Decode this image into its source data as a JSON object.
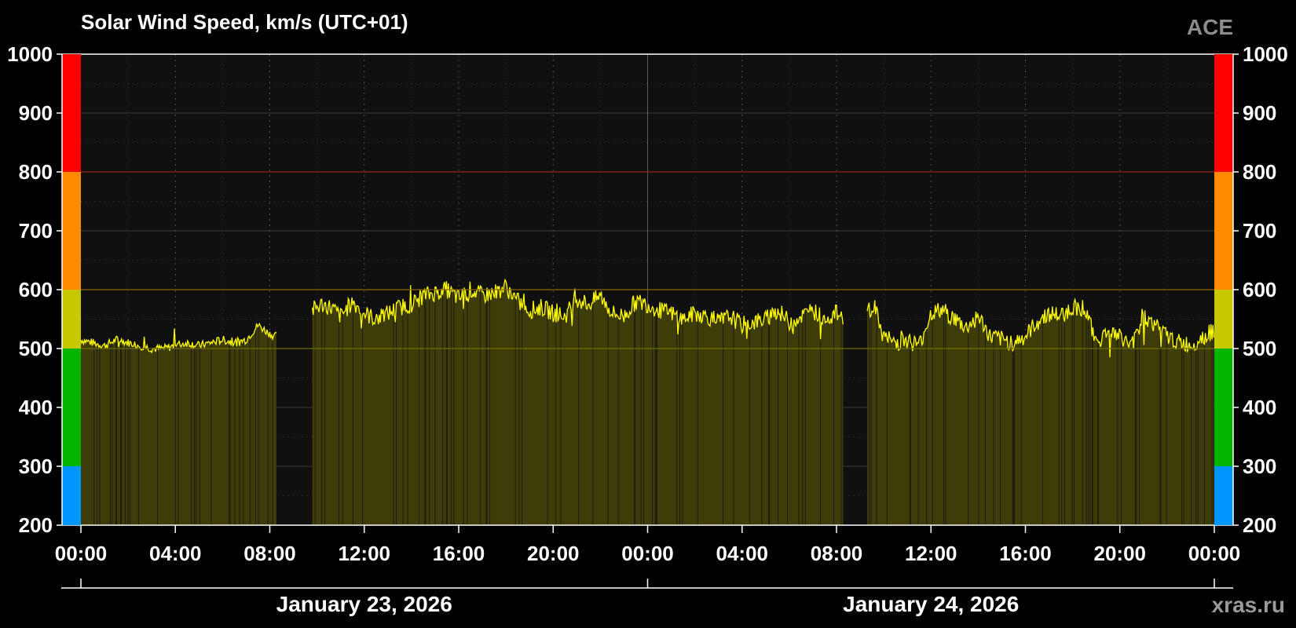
{
  "chart_data": {
    "type": "area",
    "title": "Solar Wind Speed, km/s (UTC+01)",
    "source_label": "ACE",
    "watermark": "xras.ru",
    "y_ticks": [
      200,
      300,
      400,
      500,
      600,
      700,
      800,
      900,
      1000
    ],
    "ylim": [
      200,
      1000
    ],
    "x_ticks": [
      "00:00",
      "04:00",
      "08:00",
      "12:00",
      "16:00",
      "20:00",
      "00:00",
      "04:00",
      "08:00",
      "12:00",
      "16:00",
      "20:00",
      "00:00"
    ],
    "x_range_hours": [
      0,
      48
    ],
    "date_labels": [
      {
        "text": "January 23, 2026",
        "center_hour": 12
      },
      {
        "text": "January 24, 2026",
        "center_hour": 36
      }
    ],
    "threshold_bands": [
      {
        "from": 200,
        "to": 300,
        "color": "#0096ff"
      },
      {
        "from": 300,
        "to": 500,
        "color": "#00b400"
      },
      {
        "from": 500,
        "to": 600,
        "color": "#c8c800"
      },
      {
        "from": 600,
        "to": 800,
        "color": "#ff8c00"
      },
      {
        "from": 800,
        "to": 1000,
        "color": "#ff0000"
      }
    ],
    "threshold_lines": [
      {
        "value": 500,
        "color": "#6e6e00"
      },
      {
        "value": 600,
        "color": "#8c6400"
      },
      {
        "value": 800,
        "color": "#a01e1e"
      }
    ],
    "series": [
      {
        "line_color": "#ffff00",
        "fill_color": "#3e3c08",
        "segments": [
          {
            "t": [
              0.0,
              0.5,
              1.0,
              1.5,
              2.0,
              2.5,
              3.0,
              3.5,
              4.0,
              4.5,
              5.0,
              5.5,
              6.0,
              6.5,
              7.0,
              7.5,
              8.0,
              8.3
            ],
            "v": [
              515,
              510,
              505,
              515,
              510,
              505,
              500,
              500,
              505,
              510,
              505,
              510,
              515,
              510,
              515,
              540,
              525,
              520
            ]
          },
          {
            "t": [
              9.8,
              10.2,
              10.6,
              11.0,
              11.5,
              12.0,
              12.5,
              13.0,
              13.5,
              14.0,
              14.5,
              15.0,
              15.5,
              16.0,
              16.5,
              17.0,
              17.5,
              18.0,
              18.5,
              19.0,
              19.5,
              20.0,
              20.5,
              21.0,
              21.5,
              22.0,
              22.5,
              23.0,
              23.5,
              24.0,
              24.5,
              25.0,
              25.5,
              26.0,
              26.5,
              27.0,
              27.5,
              28.0,
              28.5,
              29.0,
              29.5,
              30.0,
              30.5,
              31.0,
              31.5,
              32.0,
              32.3
            ],
            "v": [
              565,
              575,
              570,
              555,
              580,
              560,
              550,
              560,
              570,
              575,
              590,
              595,
              600,
              585,
              600,
              590,
              595,
              605,
              580,
              565,
              570,
              560,
              555,
              585,
              575,
              590,
              560,
              555,
              580,
              575,
              565,
              560,
              550,
              560,
              555,
              545,
              555,
              540,
              545,
              550,
              565,
              545,
              555,
              565,
              550,
              560,
              555
            ]
          },
          {
            "t": [
              33.3,
              33.6,
              34.0,
              34.5,
              35.0,
              35.5,
              36.0,
              36.5,
              37.0,
              37.5,
              38.0,
              38.5,
              39.0,
              39.5,
              40.0,
              40.5,
              41.0,
              41.5,
              42.0,
              42.5,
              43.0,
              43.5,
              44.0,
              44.5,
              45.0,
              45.5,
              46.0,
              46.5,
              47.0,
              47.5,
              48.0
            ],
            "v": [
              565,
              570,
              520,
              510,
              515,
              505,
              560,
              565,
              550,
              535,
              555,
              520,
              515,
              510,
              520,
              545,
              560,
              555,
              570,
              570,
              510,
              530,
              520,
              505,
              555,
              540,
              520,
              510,
              505,
              520,
              530
            ]
          }
        ]
      }
    ]
  }
}
